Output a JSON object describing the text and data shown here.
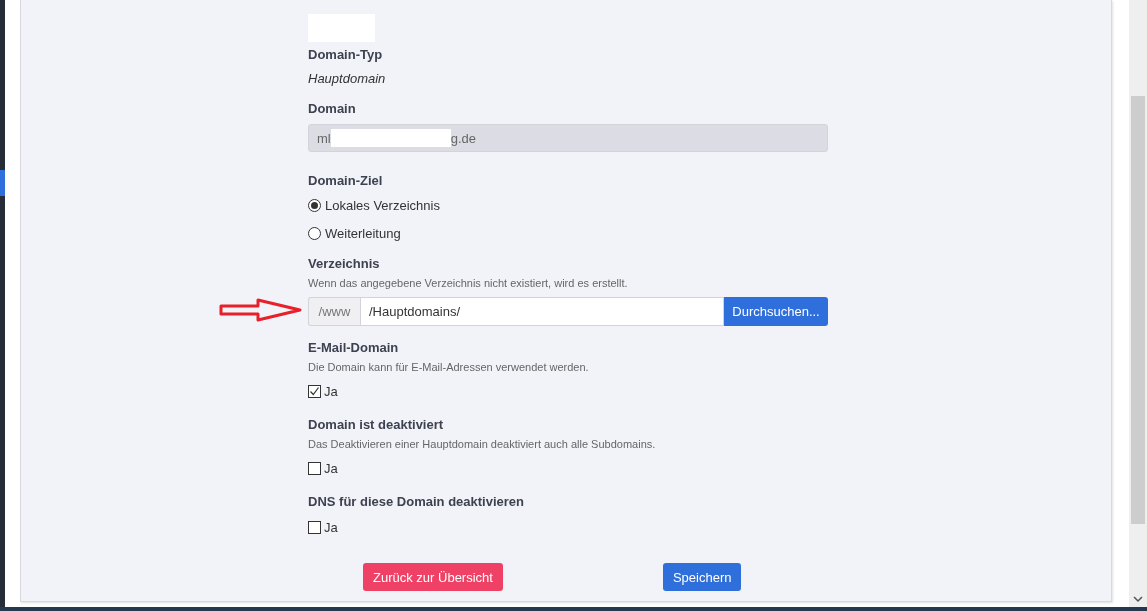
{
  "domain_type": {
    "label": "Domain-Typ",
    "value": "Hauptdomain"
  },
  "domain": {
    "label": "Domain",
    "value_start": "ml",
    "value_end": "g.de",
    "disabled": true
  },
  "domain_target": {
    "label": "Domain-Ziel",
    "options": [
      {
        "label": "Lokales Verzeichnis",
        "selected": true
      },
      {
        "label": "Weiterleitung",
        "selected": false
      }
    ]
  },
  "directory": {
    "label": "Verzeichnis",
    "hint": "Wenn das angegebene Verzeichnis nicht existiert, wird es erstellt.",
    "prefix": "/www",
    "value": "/Hauptdomains/",
    "browse_button": "Durchsuchen..."
  },
  "options": [
    {
      "label": "E-Mail-Domain",
      "hint": "Die Domain kann für E-Mail-Adressen verwendet werden.",
      "checkbox": "Ja",
      "checked": true
    },
    {
      "label": "Domain ist deaktiviert",
      "hint": "Das Deaktivieren einer Hauptdomain deaktiviert auch alle Subdomains.",
      "checkbox": "Ja",
      "checked": false
    },
    {
      "label": "DNS für diese Domain deaktivieren",
      "checkbox": "Ja",
      "checked": false
    }
  ],
  "buttons": [
    {
      "label": "Zurück zur Übersicht",
      "kind": "danger"
    },
    {
      "label": "Speichern",
      "kind": "primary"
    }
  ]
}
